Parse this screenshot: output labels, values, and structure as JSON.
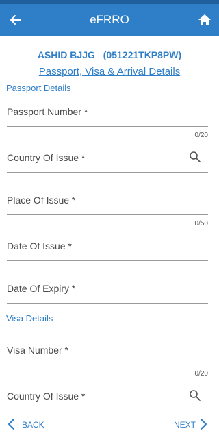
{
  "app": {
    "title": "eFRRO"
  },
  "applicant": {
    "name": "ASHID BJJG",
    "id": "(051221TKP8PW)"
  },
  "section_heading": "Passport, Visa & Arrival Details",
  "passport": {
    "group_title": "Passport Details",
    "passport_number": {
      "label": "Passport Number *",
      "counter": "0/20"
    },
    "country_of_issue": {
      "label": "Country Of Issue *"
    },
    "place_of_issue": {
      "label": "Place Of Issue *",
      "counter": "0/50"
    },
    "date_of_issue": {
      "label": "Date Of Issue *"
    },
    "date_of_expiry": {
      "label": "Date Of Expiry *"
    }
  },
  "visa": {
    "group_title": "Visa Details",
    "visa_number": {
      "label": "Visa Number *",
      "counter": "0/20"
    },
    "country_of_issue": {
      "label": "Country Of Issue *"
    }
  },
  "footer": {
    "back_label": "BACK",
    "next_label": "NEXT"
  },
  "colors": {
    "accent": "#2f7ec8",
    "appbar": "#2f7ec8",
    "statusbar": "#1f5f9e"
  },
  "icons": [
    "back-arrow-icon",
    "home-icon",
    "search-icon",
    "chevron-left-icon",
    "chevron-right-icon"
  ]
}
